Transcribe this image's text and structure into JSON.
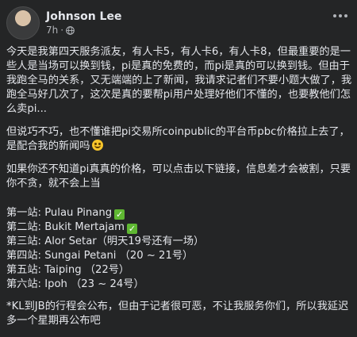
{
  "post": {
    "author": "Johnson Lee",
    "time": "7h",
    "privacy_icon": "globe-icon",
    "paragraph1": "今天是我第四天服务派友，有人卡5，有人卡6，有人卡8，但最重要的是一些人是当场可以换到钱，pi是真的免费的，而pi是真的可以换到钱。但由于我跑全马的关系，又无端端的上了新闻，我请求记者们不要小题大做了，我跑全马好几次了，这次是真的要帮pi用户处理好他们不懂的，也要教他们怎么卖pi...",
    "paragraph2": "但说巧不巧，也不懂谁把pi交易所coinpublic的平台币pbc价格拉上去了，是配合我的新闻吗",
    "paragraph3": "如果你还不知道pi真真的价格，可以点击以下链接，信息差才会被割，只要你不贪，就不会上当",
    "stations": [
      {
        "label": "第一站: Pulau Pinang",
        "checked": true
      },
      {
        "label": "第二站: Bukit Mertajam",
        "checked": true
      },
      {
        "label": "第三站: Alor Setar（明天19号还有一场）",
        "checked": false
      },
      {
        "label": "第四站: Sungai Petani （20 ~ 21号）",
        "checked": false
      },
      {
        "label": "第五站: Taiping （22号）",
        "checked": false
      },
      {
        "label": "第六站: Ipoh （23 ~ 24号）",
        "checked": false
      }
    ],
    "footnote": "*KL到JB的行程会公布，但由于记者很可恶，不让我服务你们，所以我延迟多一个星期再公布吧",
    "check_mark": "✓"
  }
}
